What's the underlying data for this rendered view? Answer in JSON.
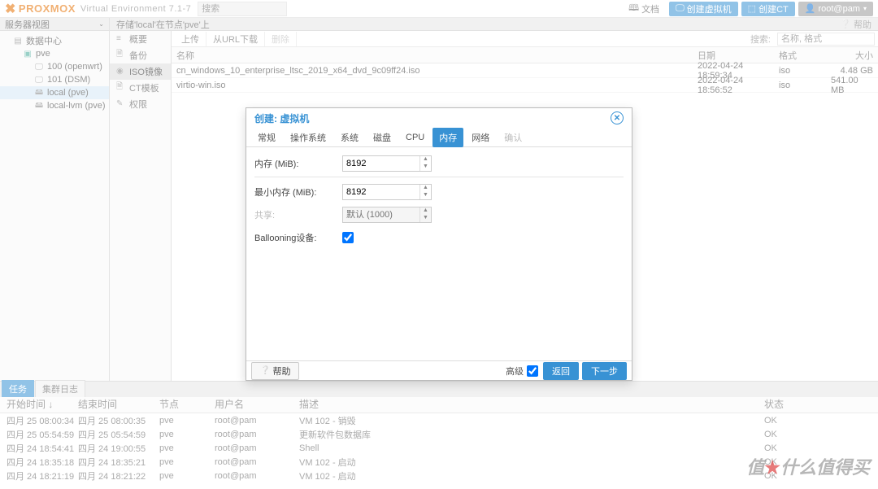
{
  "top": {
    "brand": "PROXMOX",
    "env": "Virtual Environment 7.1-7",
    "search_placeholder": "搜索",
    "doc": "文档",
    "create_vm": "创建虚拟机",
    "create_ct": "创建CT",
    "user": "root@pam"
  },
  "view": {
    "selector": "服务器视图",
    "breadcrumb": "存储'local'在节点'pve'上",
    "help": "帮助"
  },
  "tree": {
    "dc": "数据中心",
    "node": "pve",
    "items": [
      {
        "label": "100 (openwrt)"
      },
      {
        "label": "101 (DSM)"
      },
      {
        "label": "local (pve)",
        "active": true
      },
      {
        "label": "local-lvm (pve)"
      }
    ]
  },
  "midnav": {
    "items": [
      {
        "label": "概要",
        "icon": "≡"
      },
      {
        "label": "备份",
        "icon": "🗎"
      },
      {
        "label": "ISO镜像",
        "icon": "◉",
        "active": true
      },
      {
        "label": "CT模板",
        "icon": "🗎"
      },
      {
        "label": "权限",
        "icon": "✎"
      }
    ]
  },
  "toolbar": {
    "upload": "上传",
    "download": "从URL下载",
    "delete": "删除",
    "search_placeholder": "搜索:",
    "filter_placeholder": "名称, 格式"
  },
  "table": {
    "headers": {
      "name": "名称",
      "date": "日期",
      "format": "格式",
      "size": "大小"
    },
    "rows": [
      {
        "name": "cn_windows_10_enterprise_ltsc_2019_x64_dvd_9c09ff24.iso",
        "date": "2022-04-24 18:59:34",
        "format": "iso",
        "size": "4.48 GB"
      },
      {
        "name": "virtio-win.iso",
        "date": "2022-04-24 18:56:52",
        "format": "iso",
        "size": "541.00 MB"
      }
    ]
  },
  "tasks": {
    "tab_tasks": "任务",
    "tab_log": "集群日志",
    "headers": {
      "start": "开始时间 ↓",
      "end": "结束时间",
      "node": "节点",
      "user": "用户名",
      "desc": "描述",
      "status": "状态"
    },
    "rows": [
      {
        "start": "四月 25 08:00:34",
        "end": "四月 25 08:00:35",
        "node": "pve",
        "user": "root@pam",
        "desc": "VM 102 - 销毁",
        "status": "OK"
      },
      {
        "start": "四月 25 05:54:59",
        "end": "四月 25 05:54:59",
        "node": "pve",
        "user": "root@pam",
        "desc": "更新软件包数据库",
        "status": "OK"
      },
      {
        "start": "四月 24 18:54:41",
        "end": "四月 24 19:00:55",
        "node": "pve",
        "user": "root@pam",
        "desc": "Shell",
        "status": "OK"
      },
      {
        "start": "四月 24 18:35:18",
        "end": "四月 24 18:35:21",
        "node": "pve",
        "user": "root@pam",
        "desc": "VM 102 - 启动",
        "status": "OK"
      },
      {
        "start": "四月 24 18:21:19",
        "end": "四月 24 18:21:22",
        "node": "pve",
        "user": "root@pam",
        "desc": "VM 102 - 启动",
        "status": "OK"
      }
    ]
  },
  "modal": {
    "title": "创建: 虚拟机",
    "tabs": [
      "常规",
      "操作系统",
      "系统",
      "磁盘",
      "CPU",
      "内存",
      "网络",
      "确认"
    ],
    "active_tab": 5,
    "memory_label": "内存 (MiB):",
    "memory_value": "8192",
    "minmem_label": "最小内存 (MiB):",
    "minmem_value": "8192",
    "shares_label": "共享:",
    "shares_placeholder": "默认 (1000)",
    "ballooning_label": "Ballooning设备:",
    "ballooning_checked": true,
    "help": "帮助",
    "advanced": "高级",
    "advanced_checked": true,
    "back": "返回",
    "next": "下一步"
  },
  "watermark": "值★什么值得买"
}
